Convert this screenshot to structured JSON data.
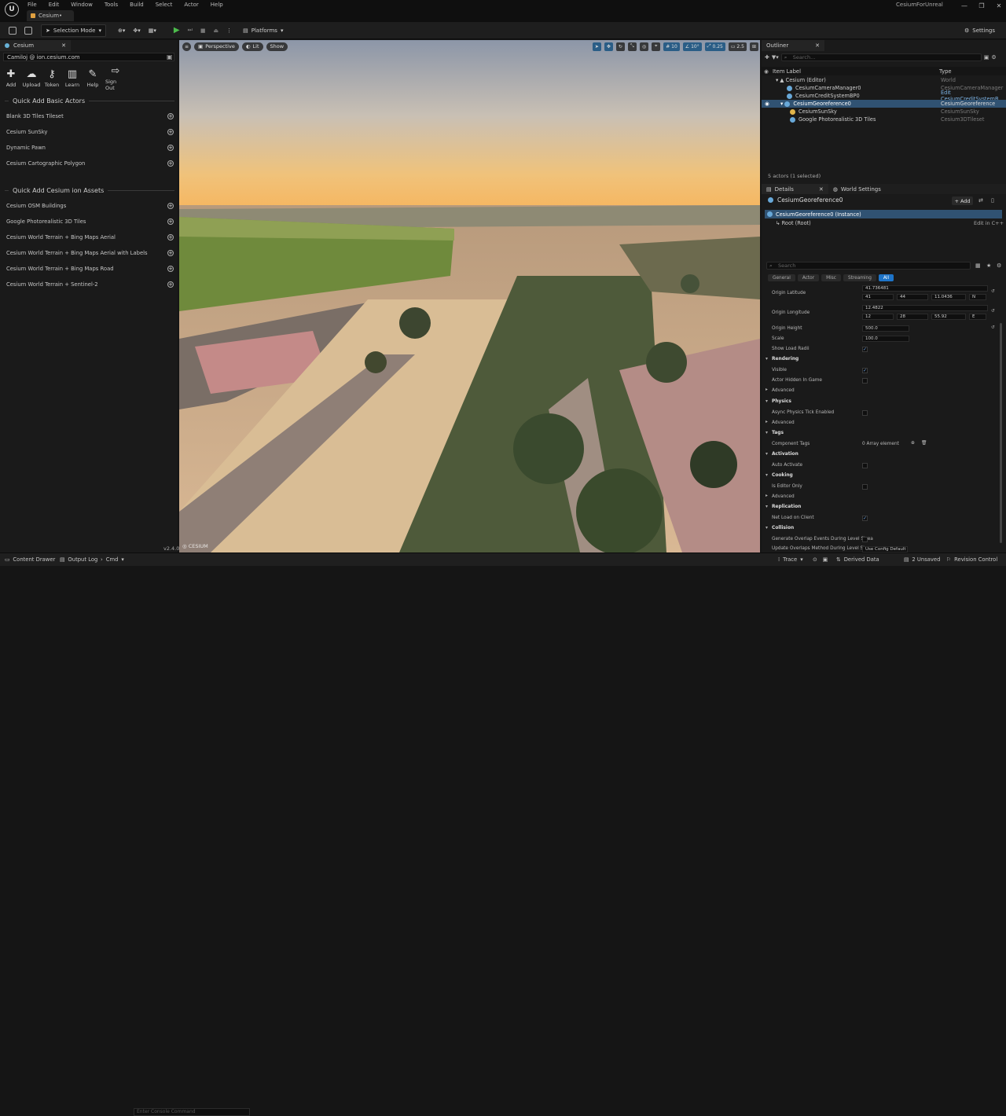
{
  "app": {
    "menu": [
      "File",
      "Edit",
      "Window",
      "Tools",
      "Build",
      "Select",
      "Actor",
      "Help"
    ],
    "doc_tab": "Cesium•",
    "project_name": "CesiumForUnreal",
    "window_controls": [
      "—",
      "❐",
      "✕"
    ]
  },
  "toolbar": {
    "selection_mode": "Selection Mode",
    "platforms": "Platforms",
    "settings": "Settings"
  },
  "cesium_panel": {
    "tab": "Cesium",
    "account": "Camiloj @ ion.cesium.com",
    "tools": [
      {
        "label": "Add",
        "icon": "plus-icon"
      },
      {
        "label": "Upload",
        "icon": "cloud-upload-icon"
      },
      {
        "label": "Token",
        "icon": "key-icon"
      },
      {
        "label": "Learn",
        "icon": "book-icon"
      },
      {
        "label": "Help",
        "icon": "wrench-icon"
      },
      {
        "label": "Sign Out",
        "icon": "sign-out-icon"
      }
    ],
    "quick_add_basic_title": "Quick Add Basic Actors",
    "quick_add_basic": [
      "Blank 3D Tiles Tileset",
      "Cesium SunSky",
      "Dynamic Pawn",
      "Cesium Cartographic Polygon"
    ],
    "quick_add_ion_title": "Quick Add Cesium ion Assets",
    "quick_add_ion": [
      "Cesium OSM Buildings",
      "Google Photorealistic 3D Tiles",
      "Cesium World Terrain + Bing Maps Aerial",
      "Cesium World Terrain + Bing Maps Aerial with Labels",
      "Cesium World Terrain + Bing Maps Road",
      "Cesium World Terrain + Sentinel-2"
    ]
  },
  "viewport": {
    "perspective": "Perspective",
    "lit": "Lit",
    "show": "Show",
    "grid_snap": "10",
    "rot_snap": "10°",
    "scale_snap": "0.25",
    "cam_speed": "2.5",
    "version": "v2.4.0"
  },
  "outliner": {
    "tab": "Outliner",
    "search_placeholder": "Search...",
    "col_label": "Item Label",
    "col_type": "Type",
    "rows": [
      {
        "label": "Cesium (Editor)",
        "type": "World",
        "indent": 1,
        "selected": false
      },
      {
        "label": "CesiumCameraManager0",
        "type": "CesiumCameraManager",
        "indent": 2,
        "selected": false
      },
      {
        "label": "CesiumCreditSystemBP0",
        "type": "Edit CesiumCreditSystemB",
        "indent": 2,
        "selected": false
      },
      {
        "label": "CesiumGeoreference0",
        "type": "CesiumGeoreference",
        "indent": 2,
        "selected": true
      },
      {
        "label": "CesiumSunSky",
        "type": "CesiumSunSky",
        "indent": 3,
        "selected": false
      },
      {
        "label": "Google Photorealistic 3D Tiles",
        "type": "Cesium3DTileset",
        "indent": 3,
        "selected": false
      }
    ],
    "count": "5 actors (1 selected)"
  },
  "details": {
    "tab": "Details",
    "world_settings": "World Settings",
    "selected_name": "CesiumGeoreference0",
    "add": "Add",
    "component_instance": "CesiumGeoreference0 (Instance)",
    "root": "Root (Root)",
    "edit_cpp": "Edit in C++",
    "search_placeholder": "Search",
    "filter_tabs": [
      "General",
      "Actor",
      "Misc",
      "Streaming",
      "All"
    ],
    "origin_latitude": {
      "label": "Origin Latitude",
      "value": "41.736481",
      "deg": "41",
      "min": "44",
      "sec": "11.0436",
      "hem": "N"
    },
    "origin_longitude": {
      "label": "Origin Longitude",
      "value": "12.4822",
      "deg": "12",
      "min": "28",
      "sec": "55.92",
      "hem": "E"
    },
    "origin_height": {
      "label": "Origin Height",
      "value": "500.0"
    },
    "scale": {
      "label": "Scale",
      "value": "100.0"
    },
    "show_load_radii": "Show Load Radii",
    "rendering": "Rendering",
    "visible": "Visible",
    "actor_hidden_in_game": "Actor Hidden In Game",
    "advanced": "Advanced",
    "physics": "Physics",
    "async_physics": "Async Physics Tick Enabled",
    "tags": "Tags",
    "component_tags": "Component Tags",
    "array_elements": "0 Array element",
    "activation": "Activation",
    "auto_activate": "Auto Activate",
    "cooking": "Cooking",
    "is_editor_only": "Is Editor Only",
    "replication": "Replication",
    "net_load_on_client": "Net Load on Client",
    "collision": "Collision",
    "generate_overlap": "Generate Overlap Events During Level Strea",
    "update_overlaps": "Update Overlaps Method During Level Strea",
    "use_config_default": "Use Config Default"
  },
  "statusbar": {
    "content_drawer": "Content Drawer",
    "output_log": "Output Log",
    "cmd": "Cmd",
    "console_placeholder": "Enter Console Command",
    "trace": "Trace",
    "derived_data": "Derived Data",
    "unsaved": "2 Unsaved",
    "revision_control": "Revision Control"
  }
}
